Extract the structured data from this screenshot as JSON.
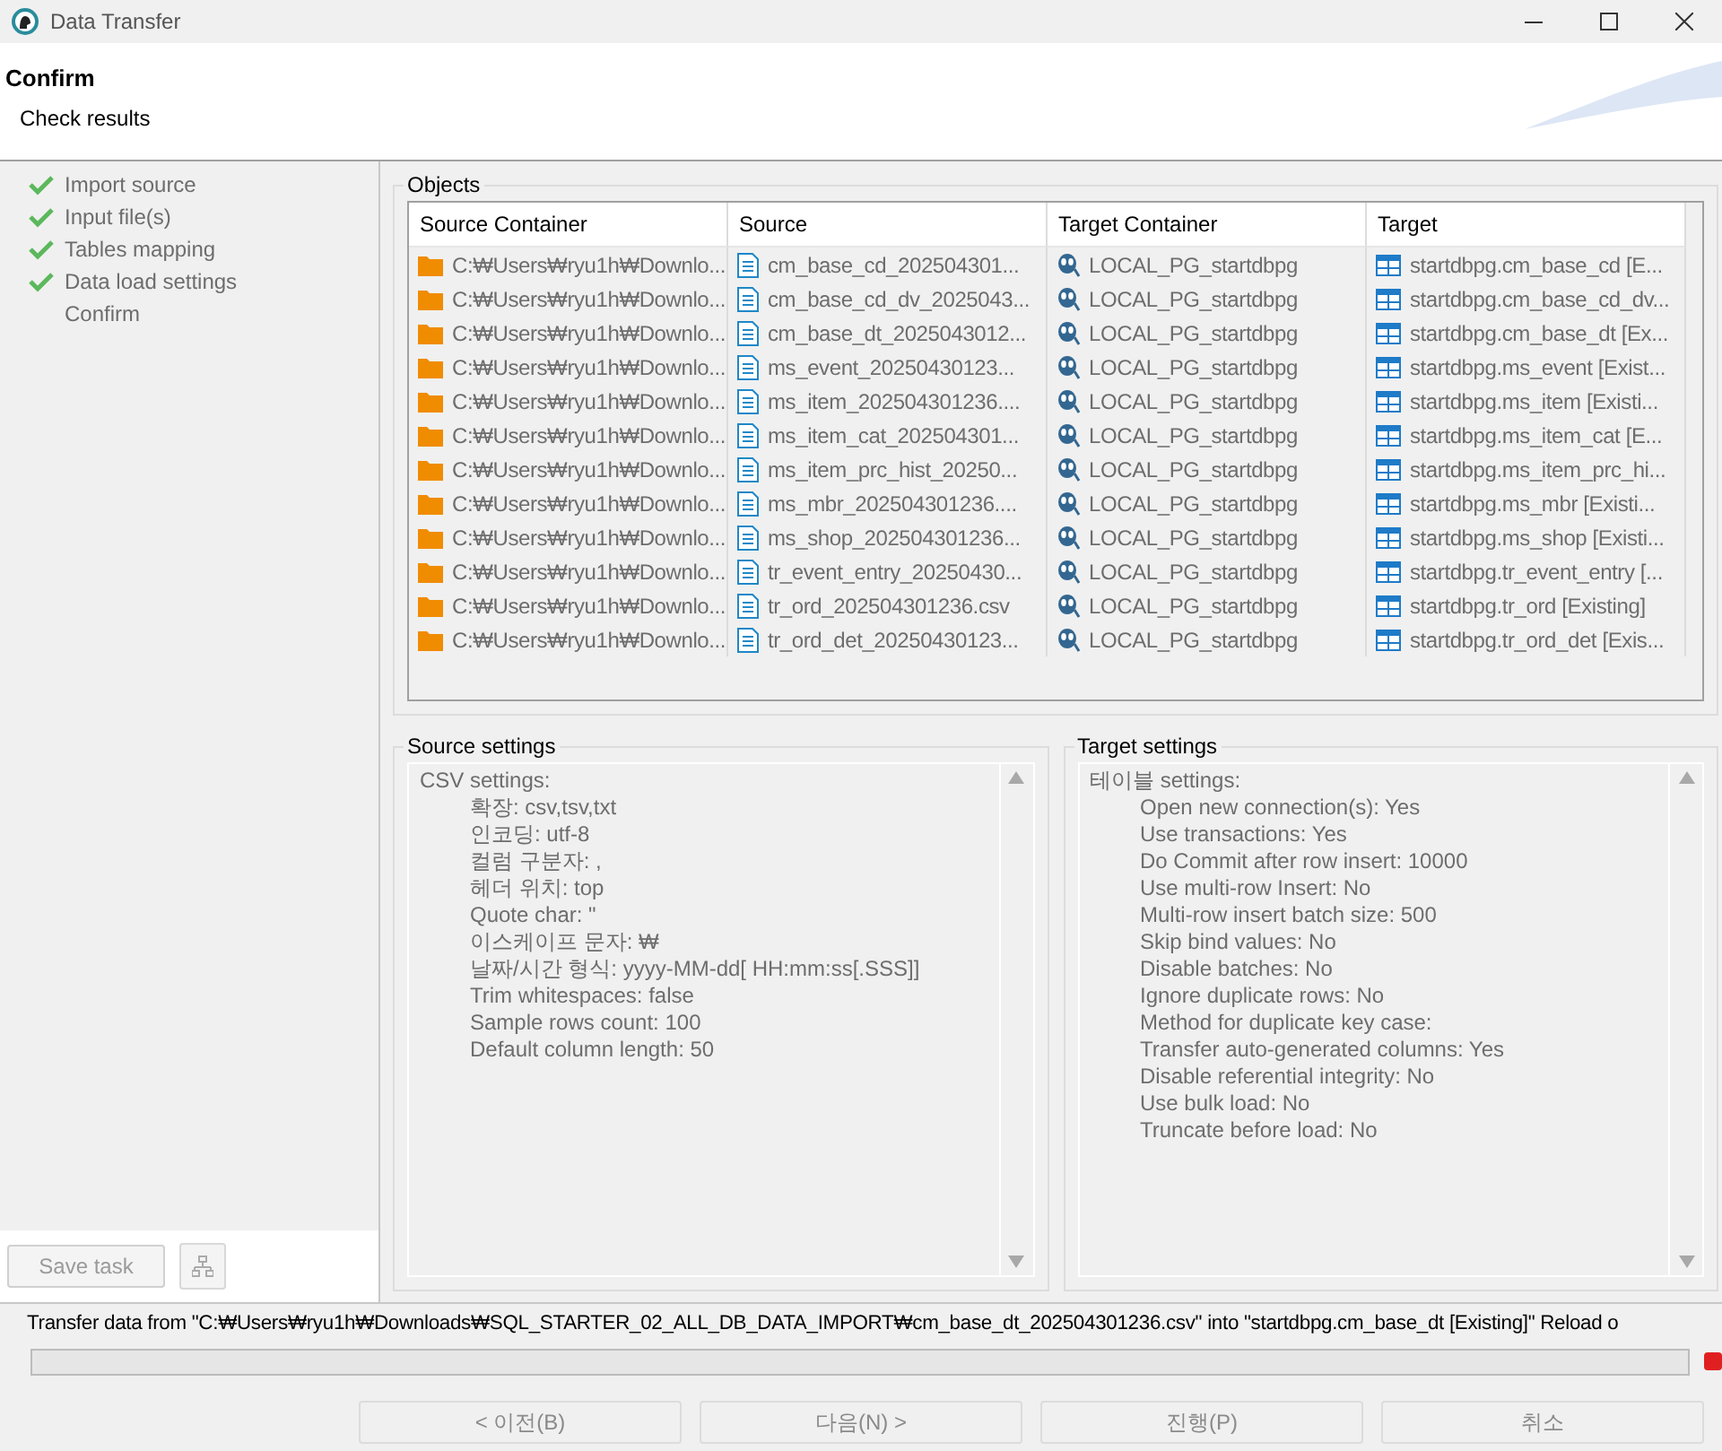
{
  "window": {
    "title": "Data Transfer"
  },
  "header": {
    "title": "Confirm",
    "subtitle": "Check results"
  },
  "steps": [
    {
      "label": "Import source",
      "checked": true
    },
    {
      "label": "Input file(s)",
      "checked": true
    },
    {
      "label": "Tables mapping",
      "checked": true
    },
    {
      "label": "Data load settings",
      "checked": true
    },
    {
      "label": "Confirm",
      "checked": false
    }
  ],
  "save_task": {
    "label": "Save task",
    "disabled": true
  },
  "objects": {
    "title": "Objects",
    "columns": [
      {
        "label": "Source Container",
        "kind": "folder"
      },
      {
        "label": "Source",
        "kind": "file"
      },
      {
        "label": "Target Container",
        "kind": "database"
      },
      {
        "label": "Target",
        "kind": "table"
      }
    ],
    "rows": [
      [
        "C:₩Users₩ryu1h₩Downlo...",
        "cm_base_cd_202504301...",
        "LOCAL_PG_startdbpg",
        "startdbpg.cm_base_cd [E..."
      ],
      [
        "C:₩Users₩ryu1h₩Downlo...",
        "cm_base_cd_dv_2025043...",
        "LOCAL_PG_startdbpg",
        "startdbpg.cm_base_cd_dv..."
      ],
      [
        "C:₩Users₩ryu1h₩Downlo...",
        "cm_base_dt_2025043012...",
        "LOCAL_PG_startdbpg",
        "startdbpg.cm_base_dt [Ex..."
      ],
      [
        "C:₩Users₩ryu1h₩Downlo...",
        "ms_event_20250430123...",
        "LOCAL_PG_startdbpg",
        "startdbpg.ms_event [Exist..."
      ],
      [
        "C:₩Users₩ryu1h₩Downlo...",
        "ms_item_202504301236....",
        "LOCAL_PG_startdbpg",
        "startdbpg.ms_item [Existi..."
      ],
      [
        "C:₩Users₩ryu1h₩Downlo...",
        "ms_item_cat_202504301...",
        "LOCAL_PG_startdbpg",
        "startdbpg.ms_item_cat [E..."
      ],
      [
        "C:₩Users₩ryu1h₩Downlo...",
        "ms_item_prc_hist_20250...",
        "LOCAL_PG_startdbpg",
        "startdbpg.ms_item_prc_hi..."
      ],
      [
        "C:₩Users₩ryu1h₩Downlo...",
        "ms_mbr_202504301236....",
        "LOCAL_PG_startdbpg",
        "startdbpg.ms_mbr [Existi..."
      ],
      [
        "C:₩Users₩ryu1h₩Downlo...",
        "ms_shop_202504301236...",
        "LOCAL_PG_startdbpg",
        "startdbpg.ms_shop [Existi..."
      ],
      [
        "C:₩Users₩ryu1h₩Downlo...",
        "tr_event_entry_20250430...",
        "LOCAL_PG_startdbpg",
        "startdbpg.tr_event_entry [..."
      ],
      [
        "C:₩Users₩ryu1h₩Downlo...",
        "tr_ord_202504301236.csv",
        "LOCAL_PG_startdbpg",
        "startdbpg.tr_ord [Existing]"
      ],
      [
        "C:₩Users₩ryu1h₩Downlo...",
        "tr_ord_det_20250430123...",
        "LOCAL_PG_startdbpg",
        "startdbpg.tr_ord_det [Exis..."
      ]
    ]
  },
  "source_settings": {
    "title": "Source settings",
    "heading": "CSV settings:",
    "lines": [
      "확장: csv,tsv,txt",
      "인코딩: utf-8",
      "컬럼 구분자: ,",
      "헤더 위치: top",
      "Quote char: \"",
      "이스케이프 문자: ₩",
      "날짜/시간 형식: yyyy-MM-dd[ HH:mm:ss[.SSS]]",
      "Trim whitespaces: false",
      "Sample rows count: 100",
      "Default column length: 50"
    ]
  },
  "target_settings": {
    "title": "Target settings",
    "heading": "테이블 settings:",
    "lines": [
      "Open new connection(s): Yes",
      "Use transactions: Yes",
      "Do Commit after row insert: 10000",
      "Use multi-row Insert: No",
      "Multi-row insert batch size: 500",
      "Skip bind values: No",
      "Disable batches: No",
      "Ignore duplicate rows: No",
      "Method for duplicate key case:",
      "Transfer auto-generated columns: Yes",
      "Disable referential integrity: No",
      "Use bulk load: No",
      "Truncate before load: No"
    ]
  },
  "status": {
    "message": "Transfer data from \"C:₩Users₩ryu1h₩Downloads₩SQL_STARTER_02_ALL_DB_DATA_IMPORT₩cm_base_dt_202504301236.csv\" into \"startdbpg.cm_base_dt [Existing]\" Reload o",
    "level": 0
  },
  "buttons": [
    {
      "label": "< 이전(B)",
      "disabled": true
    },
    {
      "label": "다음(N) >",
      "disabled": true
    },
    {
      "label": "진행(P)",
      "disabled": true
    },
    {
      "label": "취소",
      "disabled": true
    }
  ]
}
